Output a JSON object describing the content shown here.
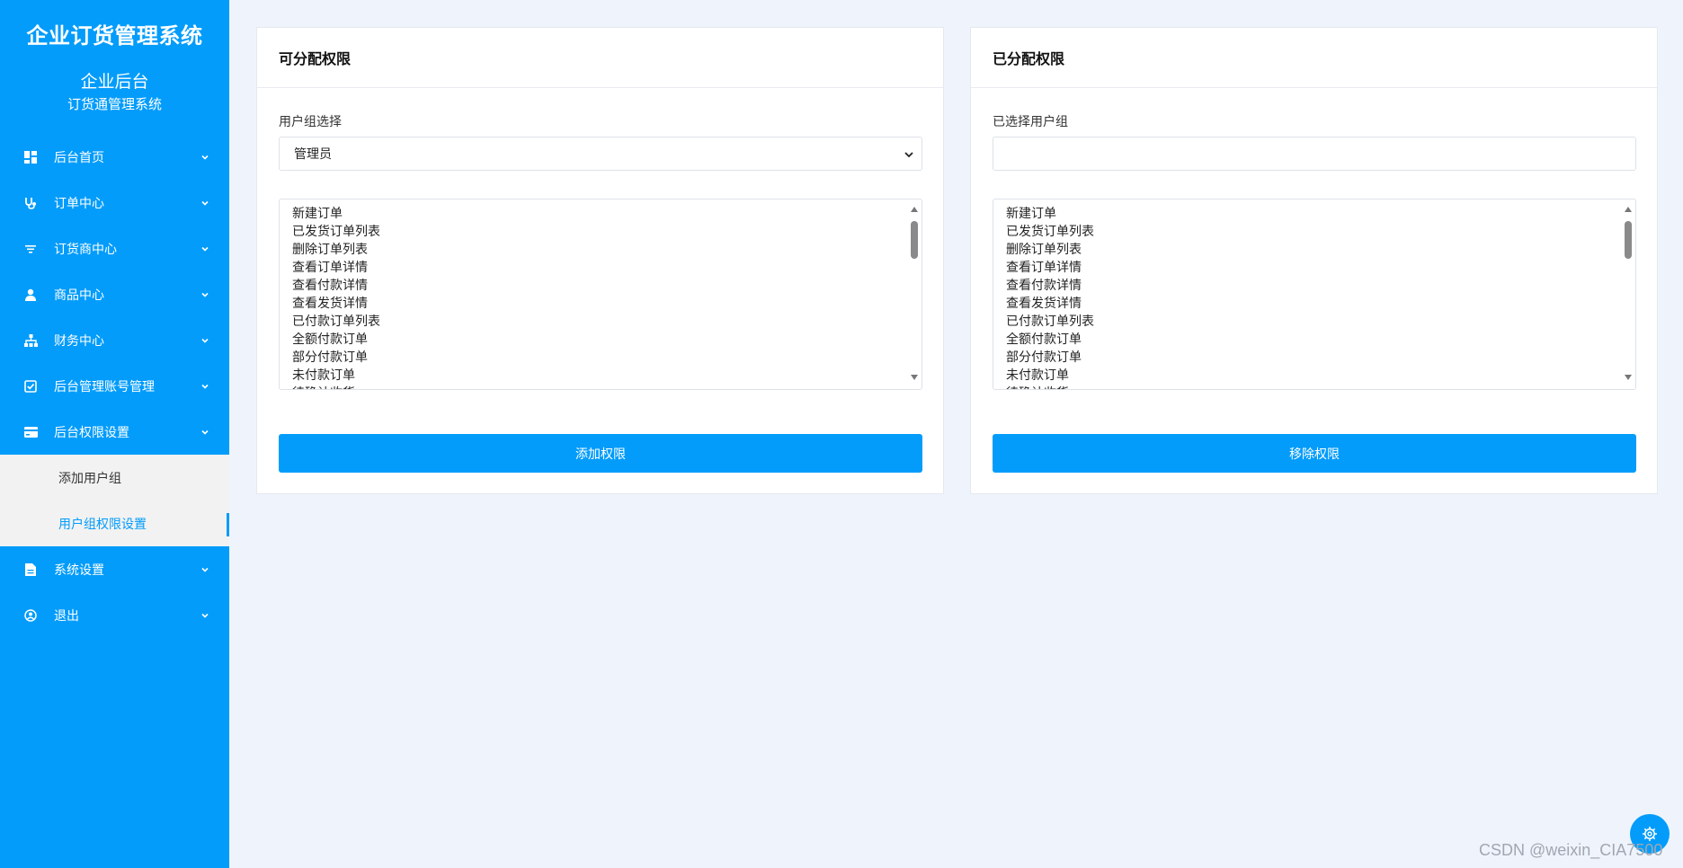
{
  "sidebar": {
    "brand": "企业订货管理系统",
    "sub_title": "企业后台",
    "sub_caption": "订货通管理系统",
    "items": [
      {
        "label": "后台首页",
        "icon": "dashboard-icon"
      },
      {
        "label": "订单中心",
        "icon": "stethoscope-icon"
      },
      {
        "label": "订货商中心",
        "icon": "filter-icon"
      },
      {
        "label": "商品中心",
        "icon": "user-icon"
      },
      {
        "label": "财务中心",
        "icon": "sitemap-icon"
      },
      {
        "label": "后台管理账号管理",
        "icon": "checkbox-icon"
      },
      {
        "label": "后台权限设置",
        "icon": "card-icon"
      },
      {
        "label": "系统设置",
        "icon": "document-icon"
      },
      {
        "label": "退出",
        "icon": "user-circle-icon"
      }
    ],
    "submenu": [
      {
        "label": "添加用户组",
        "active": false
      },
      {
        "label": "用户组权限设置",
        "active": true
      }
    ],
    "accent_color": "#039cfb"
  },
  "left_panel": {
    "title": "可分配权限",
    "field_label": "用户组选择",
    "selected_group": "管理员",
    "permissions": [
      "新建订单",
      "已发货订单列表",
      "删除订单列表",
      "查看订单详情",
      "查看付款详情",
      "查看发货详情",
      "已付款订单列表",
      "全额付款订单",
      "部分付款订单",
      "未付款订单",
      "待确认收货"
    ],
    "button_label": "添加权限"
  },
  "right_panel": {
    "title": "已分配权限",
    "field_label": "已选择用户组",
    "selected_group": "",
    "permissions": [
      "新建订单",
      "已发货订单列表",
      "删除订单列表",
      "查看订单详情",
      "查看付款详情",
      "查看发货详情",
      "已付款订单列表",
      "全额付款订单",
      "部分付款订单",
      "未付款订单",
      "待确认收货"
    ],
    "button_label": "移除权限"
  },
  "watermark": "CSDN @weixin_CIA7500"
}
